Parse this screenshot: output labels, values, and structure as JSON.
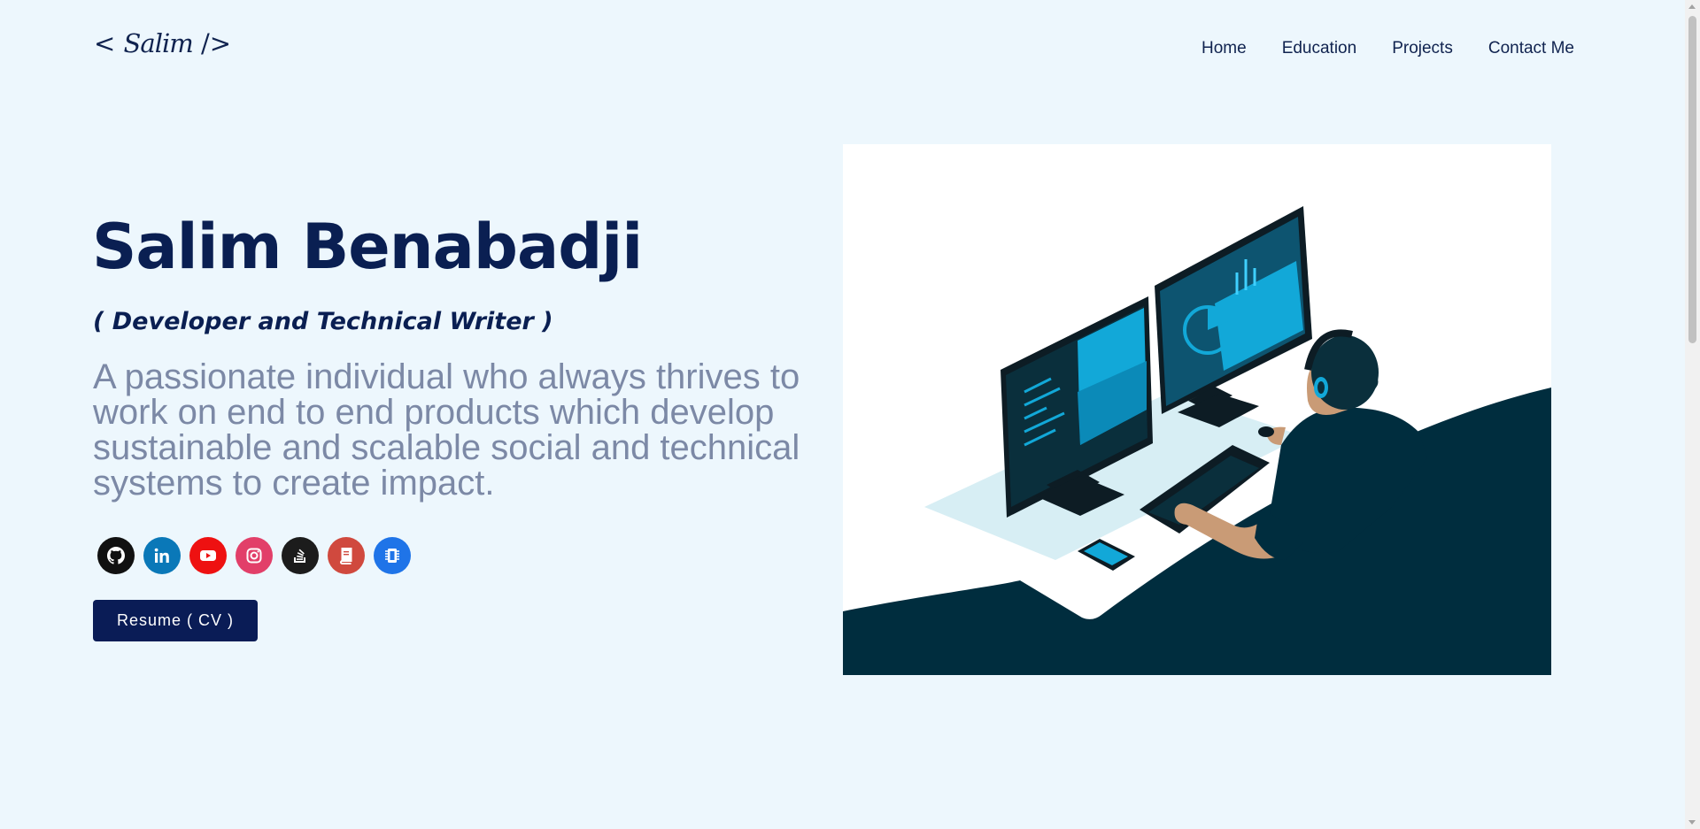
{
  "header": {
    "logo_open": "< ",
    "logo_name": "Salim",
    "logo_close": " />",
    "nav": [
      {
        "label": "Home"
      },
      {
        "label": "Education"
      },
      {
        "label": "Projects"
      },
      {
        "label": "Contact Me"
      }
    ]
  },
  "hero": {
    "name": "Salim Benabadji",
    "role": "( Developer and Technical Writer )",
    "description": "A passionate individual who always thrives to work on end to end products which develop sustainable and scalable social and technical systems to create impact.",
    "resume_label": "Resume ( CV )"
  },
  "socials": [
    {
      "icon": "github-icon",
      "color": "#111111"
    },
    {
      "icon": "linkedin-icon",
      "color": "#0a78b8"
    },
    {
      "icon": "youtube-icon",
      "color": "#ee1111"
    },
    {
      "icon": "instagram-icon",
      "color": "#e23f69"
    },
    {
      "icon": "stackoverflow-icon",
      "color": "#1c1c1c"
    },
    {
      "icon": "book-icon",
      "color": "#d0493e"
    },
    {
      "icon": "chip-icon",
      "color": "#1f74e8"
    }
  ],
  "colors": {
    "background": "#edf7fd",
    "primary": "#0a1f52",
    "muted_text": "#7c89a6",
    "button": "#0a1c56",
    "illustration_dark": "#002d3e",
    "illustration_accent": "#12a8d8"
  }
}
